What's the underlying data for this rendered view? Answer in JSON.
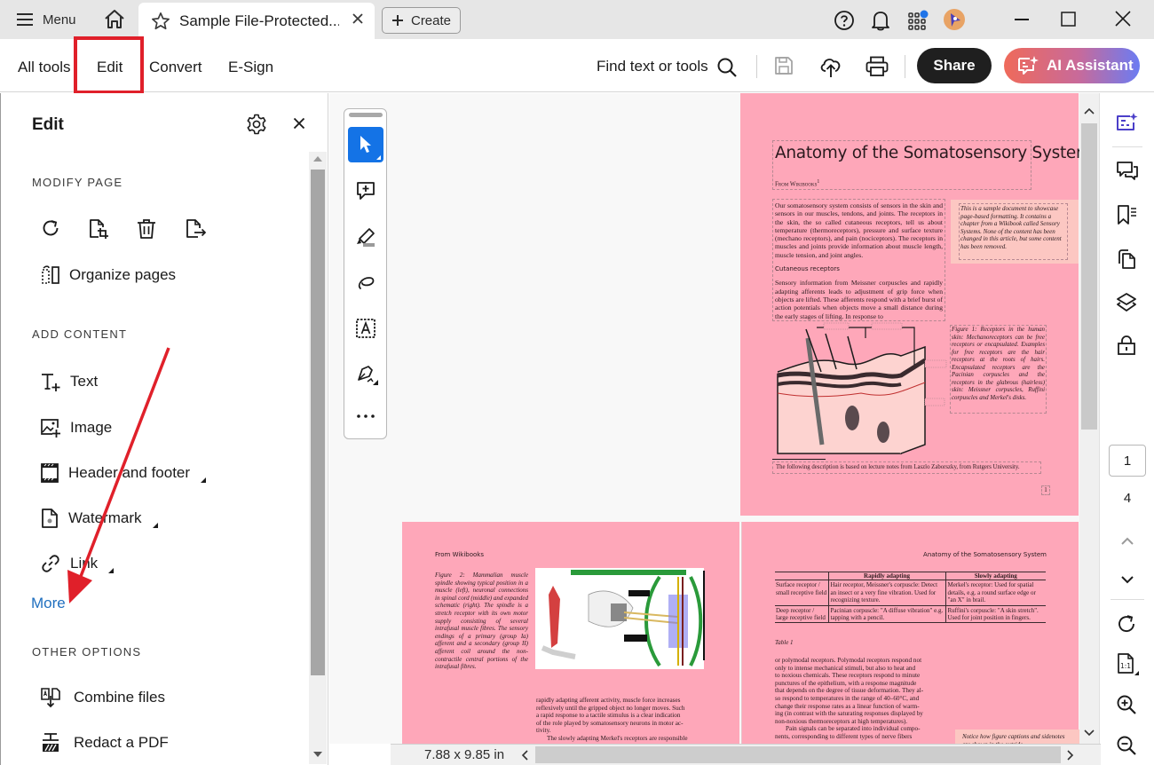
{
  "titlebar": {
    "menu_label": "Menu",
    "tab_title": "Sample File-Protected....",
    "create_label": "Create",
    "icons": [
      "help-icon",
      "bell-icon",
      "apps-grid-icon",
      "avatar",
      "minimize-icon",
      "maximize-icon",
      "close-icon"
    ]
  },
  "toolbar": {
    "nav": [
      {
        "label": "All tools"
      },
      {
        "label": "Edit",
        "active": true
      },
      {
        "label": "Convert"
      },
      {
        "label": "E-Sign"
      }
    ],
    "find_label": "Find text or tools",
    "share_label": "Share",
    "ai_label": "AI Assistant",
    "accent_colors": {
      "share": "#1f1f1f",
      "ai_gradient_start": "#ef6a5a",
      "ai_gradient_end": "#6b7cf2",
      "highlight": "#e0202a"
    }
  },
  "panel": {
    "title": "Edit",
    "sections": {
      "modify_page": "MODIFY PAGE",
      "add_content": "ADD CONTENT",
      "other_options": "OTHER OPTIONS"
    },
    "modify_icons": [
      "rotate-icon",
      "crop-page-icon",
      "delete-icon",
      "extract-page-icon"
    ],
    "organize_label": "Organize pages",
    "add_items": [
      {
        "label": "Text",
        "icon": "text-add-icon",
        "has_submenu": false
      },
      {
        "label": "Image",
        "icon": "image-add-icon",
        "has_submenu": false
      },
      {
        "label": "Header and footer",
        "icon": "header-footer-icon",
        "has_submenu": true
      },
      {
        "label": "Watermark",
        "icon": "watermark-icon",
        "has_submenu": true
      },
      {
        "label": "Link",
        "icon": "link-icon",
        "has_submenu": true
      }
    ],
    "more_label": "More",
    "other_items": [
      {
        "label": "Combine files",
        "icon": "combine-files-icon"
      },
      {
        "label": "Redact a PDF",
        "icon": "redact-icon"
      }
    ]
  },
  "document": {
    "page1": {
      "title": "Anatomy of the Somatosensory System",
      "byline": "From Wikibooks",
      "footnote_marker": "1",
      "intro": "Our somatosensory system consists of sensors in the skin and sensors in our muscles, tendons, and joints. The receptors in the skin, the so called cutaneous receptors, tell us about temperature (thermoreceptors), pressure and surface texture (mechano receptors), and pain (nociceptors). The receptors in muscles and joints provide information about muscle length, muscle tension, and joint angles.",
      "subheading": "Cutaneous receptors",
      "body": "Sensory information from Meissner corpuscles and rapidly adapting afferents leads to adjustment of grip force when objects are lifted. These afferents respond with a brief burst of action potentials when objects move a small distance during the early stages of lifting. In response to",
      "sidenote": "This is a sample document to showcase page-based formatting. It contains a chapter from a Wikibook called Sensory Systems. None of the content has been changed in this article, but some content has been removed.",
      "figure_caption": "Figure 1: Receptors in the human skin: Mechanoreceptors can be free receptors or encapsulated. Examples for free receptors are the hair receptors at the roots of hairs. Encapsulated receptors are the Pacinian corpuscles and the receptors in the glabrous (hairless) skin: Meissner corpuscles, Ruffini corpuscles and Merkel's disks.",
      "footnote": "The following description is based on lecture notes from Laszlo Zaborszky, from Rutgers University.",
      "page_number": "1"
    },
    "page2": {
      "header": "From Wikibooks",
      "figure_caption": "Figure 2: Mammalian muscle spindle showing typical position in a muscle (left), neuronal connections in spinal cord (middle) and expanded schematic (right). The spindle is a stretch receptor with its own motor supply consisting of several intrafusal muscle fibres. The sensory endings of a primary (group Ia) afferent and a secondary (group II) afferent coil around the non-contractile central portions of the intrafusal fibres.",
      "body_lines": [
        "rapidly adapting afferent activity, muscle force increases",
        "reflexively until the gripped object no longer moves. Such",
        "a rapid response to a tactile stimulus is a clear indication",
        "of the role played by somatosensory neurons in motor ac-",
        "tivity.",
        "The slowly adapting Merkel's receptors are responsible"
      ]
    },
    "page3": {
      "header": "Anatomy of the Somatosensory System",
      "table": {
        "columns": [
          "",
          "Rapidly adapting",
          "Slowly adapting"
        ],
        "rows": [
          [
            "Surface receptor / small receptive field",
            "Hair receptor, Meissner's corpuscle: Detect an insect or a very fine vibration. Used for recognizing texture.",
            "Merkel's receptor: Used for spatial details, e.g. a round surface edge or \"an X\" in brail."
          ],
          [
            "Deep receptor / large receptive field",
            "Pacinian corpuscle: \"A diffuse vibration\" e.g. tapping with a pencil.",
            "Ruffini's corpuscle: \"A skin stretch\". Used for joint position in fingers."
          ]
        ],
        "caption": "Table 1"
      },
      "body_lines": [
        "or polymodal receptors. Polymodal receptors respond not",
        "only to intense mechanical stimuli, but also to heat and",
        "to noxious chemicals. These receptors respond to minute",
        "punctures of the epithelium, with a response magnitude",
        "that depends on the degree of tissue deformation. They al-",
        "so respond to temperatures in the range of 40–60°C, and",
        "change their response rates as a linear function of warm-",
        "ing (in contrast with the saturating responses displayed by",
        "non-noxious thermoreceptors at high temperatures).",
        "Pain signals can be separated into individual compo-",
        "nents, corresponding to different types of nerve fibers"
      ],
      "sidenote": "Notice how figure captions and sidenotes are shown in the outside"
    },
    "page_background": "#fea7b9"
  },
  "navigation": {
    "current_page": "1",
    "total_pages": "4"
  },
  "status": {
    "page_size": "7.88 x 9.85 in"
  }
}
